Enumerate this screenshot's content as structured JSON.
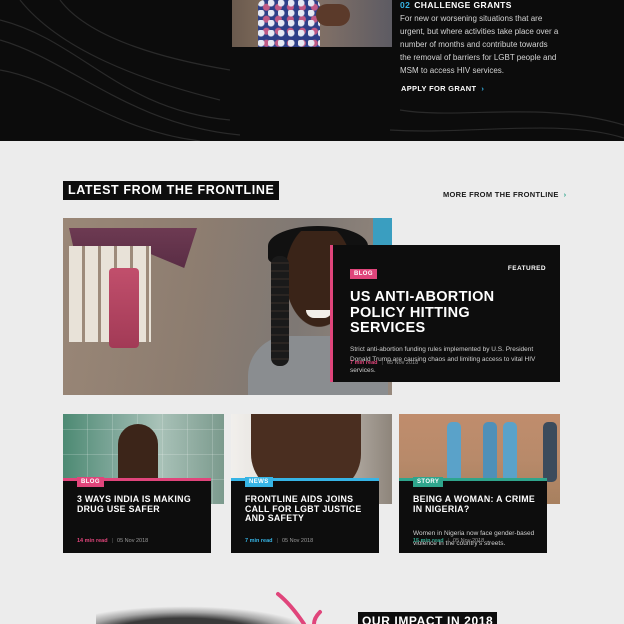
{
  "top": {
    "grant_number": "02",
    "grant_title": "CHALLENGE GRANTS",
    "grant_description": "For new or worsening situations that are urgent, but where activities take place over a number of months and contribute towards the removal of barriers for LGBT people and MSM to access HIV services.",
    "apply_label": "APPLY FOR GRANT"
  },
  "latest": {
    "heading": "LATEST FROM THE FRONTLINE",
    "more_label": "MORE FROM THE FRONTLINE",
    "featured": {
      "tag": "BLOG",
      "label": "FEATURED",
      "title": "US ANTI-ABORTION POLICY HITTING SERVICES",
      "description": "Strict anti-abortion funding rules implemented by U.S. President Donald Trump are causing chaos and limiting access to vital HIV services.",
      "read_time": "7 min read",
      "date": "05 Nov 2018"
    },
    "cards": [
      {
        "tag": "BLOG",
        "title": "3 WAYS INDIA IS MAKING DRUG USE SAFER",
        "description": "",
        "read_time": "14 min read",
        "date": "05 Nov 2018"
      },
      {
        "tag": "NEWS",
        "title": "FRONTLINE AIDS JOINS CALL FOR LGBT JUSTICE AND SAFETY",
        "description": "",
        "read_time": "7 min read",
        "date": "05 Nov 2018"
      },
      {
        "tag": "STORY",
        "title": "BEING A WOMAN: A CRIME IN NIGERIA?",
        "description": "Women in Nigeria now face gender-based violence in the country's streets.",
        "read_time": "15 min read",
        "date": "05 Nov 2018"
      }
    ]
  },
  "impact": {
    "heading": "OUR IMPACT IN 2018"
  },
  "icons": {
    "link_chevron": "chevron-right-icon"
  },
  "colors": {
    "blog_pink": "#e0457b",
    "news_blue": "#36b4e5",
    "story_green": "#2fa58c",
    "dark": "#0d0d0d",
    "light_bg": "#ececec"
  }
}
